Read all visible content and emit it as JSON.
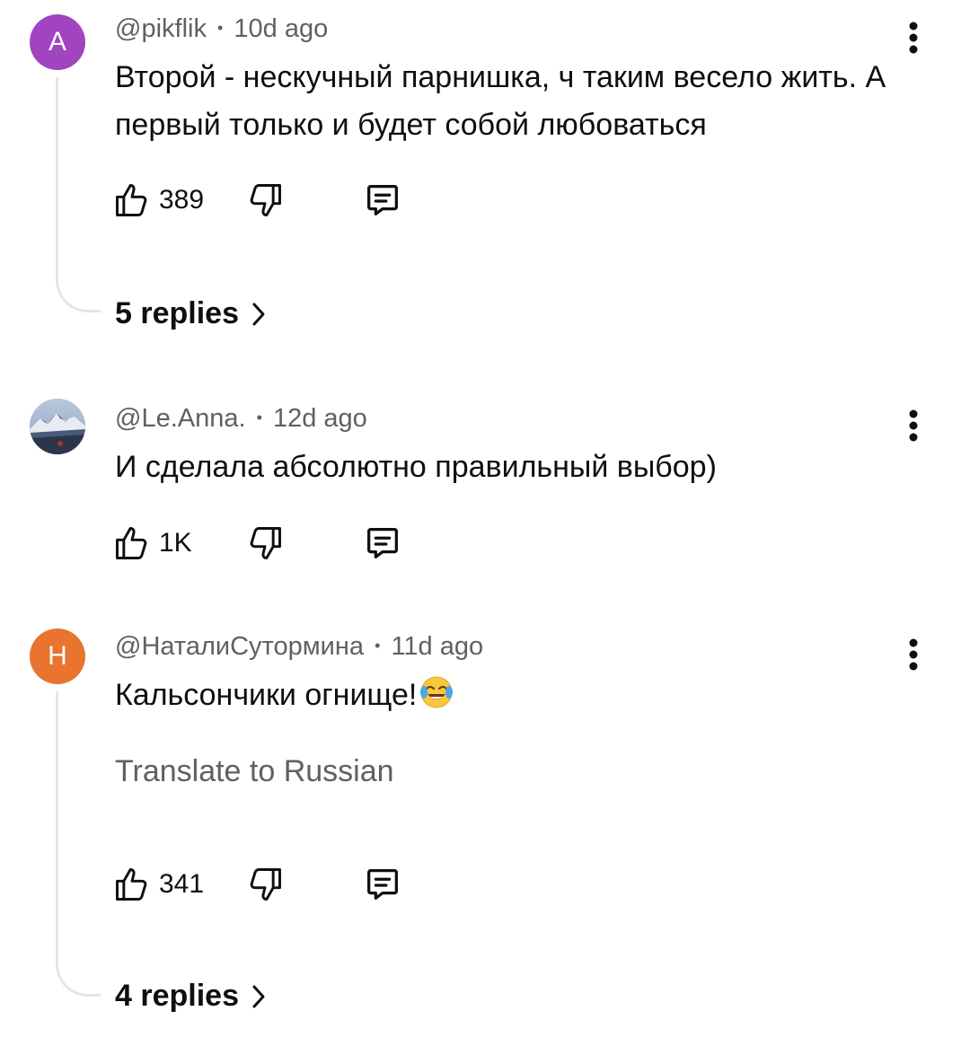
{
  "comments": [
    {
      "avatar_letter": "A",
      "avatar_color": "#a044c0",
      "handle": "@pikflik",
      "time": "10d ago",
      "text": "Второй - нескучный парнишка, ч таким весело жить. А первый только и будет собой любоваться",
      "likes": "389",
      "replies_label": "5 replies"
    },
    {
      "avatar_letter": "",
      "avatar_image": "mountain-landscape-photo",
      "handle": "@Le.Anna.",
      "time": "12d ago",
      "text": "И сделала абсолютно правильный выбор)",
      "likes": "1K"
    },
    {
      "avatar_letter": "Н",
      "avatar_color": "#e8742f",
      "handle": "@НаталиСутормина",
      "time": "11d ago",
      "text": "Кальсончики огнище!",
      "emoji": "face-with-tears-of-joy",
      "translate_label": "Translate to Russian",
      "likes": "341",
      "replies_label": "4 replies"
    }
  ],
  "separator": "•"
}
